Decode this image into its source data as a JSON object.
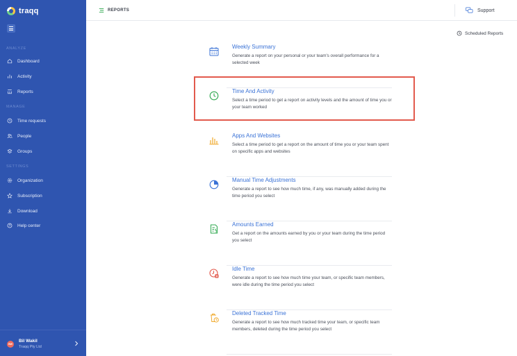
{
  "app": {
    "name": "traqq"
  },
  "sidebar": {
    "sections": [
      {
        "label": "ANALYZE",
        "items": [
          {
            "label": "Dashboard",
            "icon": "home-icon"
          },
          {
            "label": "Activity",
            "icon": "bar-chart-icon"
          },
          {
            "label": "Reports",
            "icon": "reports-icon"
          }
        ]
      },
      {
        "label": "MANAGE",
        "items": [
          {
            "label": "Time requests",
            "icon": "clock-icon"
          },
          {
            "label": "People",
            "icon": "people-icon"
          },
          {
            "label": "Groups",
            "icon": "groups-icon"
          }
        ]
      },
      {
        "label": "SETTINGS",
        "items": [
          {
            "label": "Organization",
            "icon": "gear-icon"
          },
          {
            "label": "Subscription",
            "icon": "star-icon"
          },
          {
            "label": "Download",
            "icon": "download-icon"
          },
          {
            "label": "Help center",
            "icon": "help-icon"
          }
        ]
      }
    ],
    "user": {
      "initials": "BW",
      "name": "Bil Wakil",
      "company": "Traqq Pty Ltd"
    }
  },
  "header": {
    "title": "REPORTS",
    "support_label": "Support"
  },
  "scheduled_reports_label": "Scheduled Reports",
  "reports": [
    {
      "title": "Weekly Summary",
      "description": "Generate a report on your personal or your team's overall performance for a selected week",
      "icon": "calendar-icon",
      "icon_color": "#3a72d6"
    },
    {
      "title": "Time And Activity",
      "description": "Select a time period to get a report on activity levels and the amount of time you or your team worked",
      "icon": "clock-icon",
      "icon_color": "#2fa84f"
    },
    {
      "title": "Apps And Websites",
      "description": "Select a time period to get a report on the amount of time you or your team spent on specific apps and websites",
      "icon": "bar-chart-icon",
      "icon_color": "#f0a92b"
    },
    {
      "title": "Manual Time Adjustments",
      "description": "Generate a report to see how much time, if any, was manually added during the time period you select",
      "icon": "pie-chart-icon",
      "icon_color": "#3a72d6"
    },
    {
      "title": "Amounts Earned",
      "description": "Get a report on the amounts earned by you or your team during the time period you select",
      "icon": "money-document-icon",
      "icon_color": "#2fa84f"
    },
    {
      "title": "Idle Time",
      "description": "Generate a report to see how much time your team, or specific team members, were idle during the time period you select",
      "icon": "idle-clock-icon",
      "icon_color": "#e2594c"
    },
    {
      "title": "Deleted Tracked Time",
      "description": "Generate a report to see how much tracked time your team, or specific team members, deleted during the time period you select",
      "icon": "deleted-time-icon",
      "icon_color": "#f0a92b"
    }
  ],
  "highlighted_report": "Time And Activity"
}
